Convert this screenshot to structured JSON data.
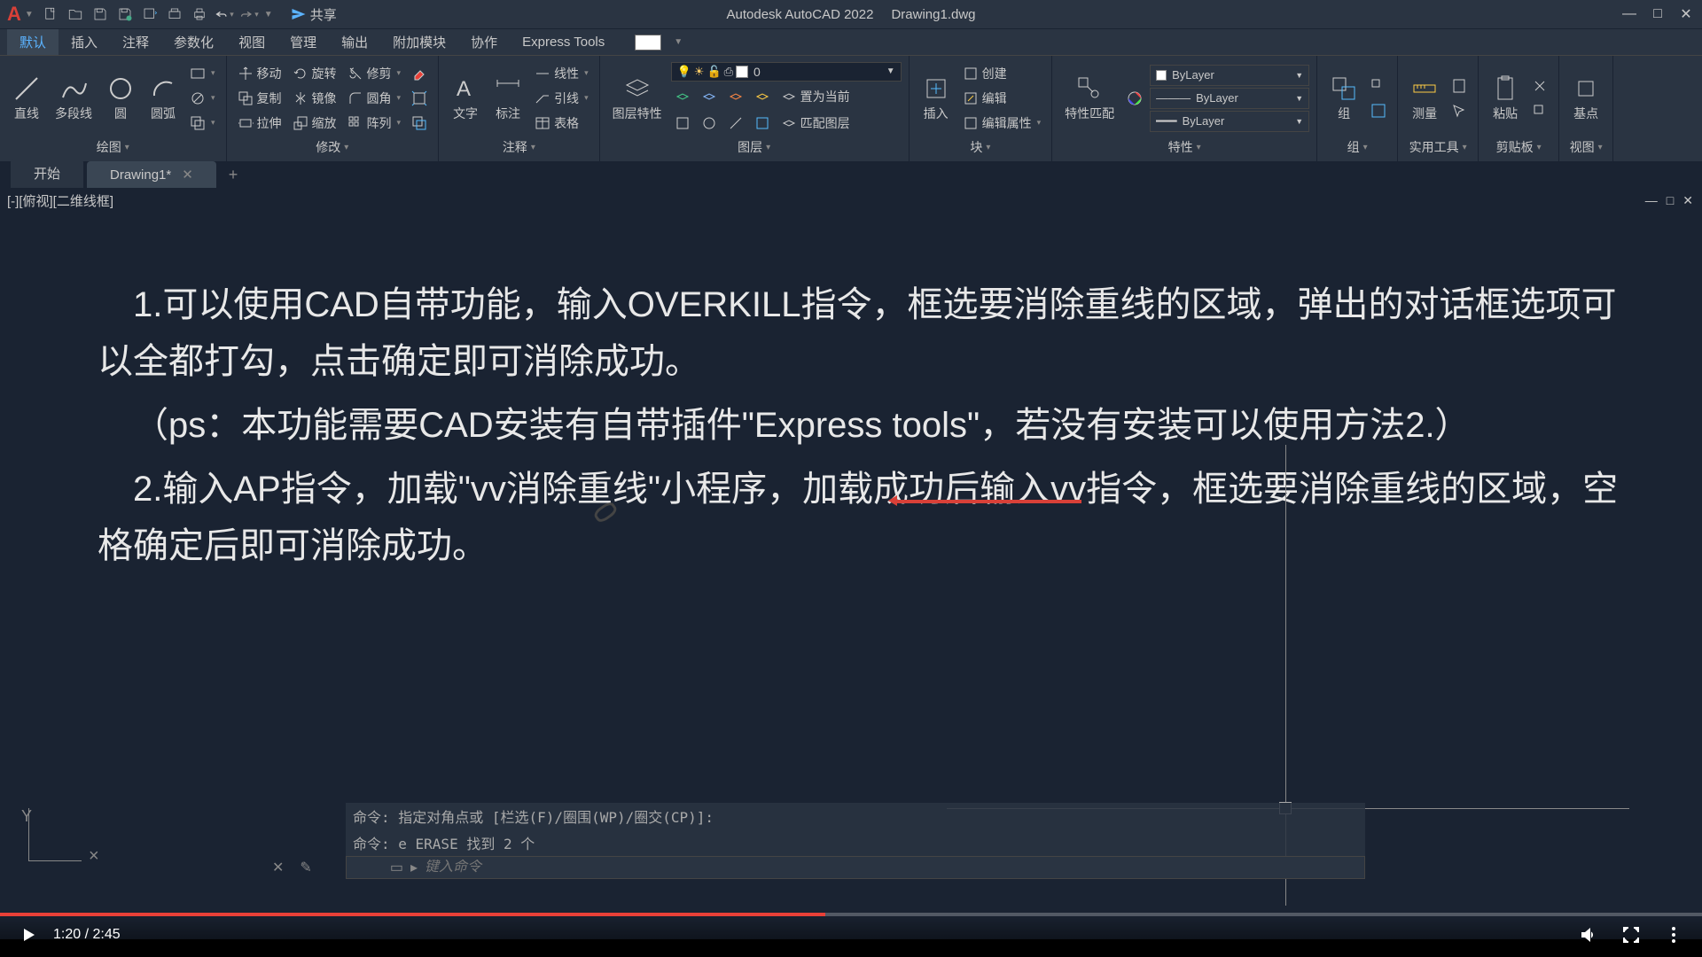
{
  "titlebar": {
    "app": "Autodesk AutoCAD 2022",
    "file": "Drawing1.dwg",
    "share": "共享"
  },
  "menubar": {
    "items": [
      "默认",
      "插入",
      "注释",
      "参数化",
      "视图",
      "管理",
      "输出",
      "附加模块",
      "协作",
      "Express Tools"
    ]
  },
  "ribbon": {
    "draw": {
      "label": "绘图",
      "line": "直线",
      "pline": "多段线",
      "circle": "圆",
      "arc": "圆弧"
    },
    "modify": {
      "label": "修改",
      "move": "移动",
      "rotate": "旋转",
      "trim": "修剪",
      "copy": "复制",
      "mirror": "镜像",
      "fillet": "圆角",
      "stretch": "拉伸",
      "scale": "缩放",
      "array": "阵列"
    },
    "annot": {
      "label": "注释",
      "text": "文字",
      "dim": "标注",
      "linear": "线性",
      "leader": "引线",
      "table": "表格"
    },
    "layers": {
      "label": "图层",
      "props": "图层特性",
      "current": "0",
      "setcurrent": "置为当前",
      "match": "匹配图层"
    },
    "block": {
      "label": "块",
      "insert": "插入",
      "create": "创建",
      "edit": "编辑",
      "attr": "编辑属性"
    },
    "props": {
      "label": "特性",
      "match": "特性匹配",
      "bylayer": "ByLayer"
    },
    "group": {
      "label": "组",
      "group": "组"
    },
    "util": {
      "label": "实用工具",
      "measure": "测量"
    },
    "clip": {
      "label": "剪贴板",
      "paste": "粘贴"
    },
    "view": {
      "label": "视图",
      "base": "基点"
    }
  },
  "filetabs": {
    "start": "开始",
    "drawing": "Drawing1*"
  },
  "viewport": {
    "label": "[-][俯视][二维线框]"
  },
  "content": {
    "p1": "1.可以使用CAD自带功能，输入OVERKILL指令，框选要消除重线的区域，弹出的对话框选项可以全都打勾，点击确定即可消除成功。",
    "p2": "（ps：本功能需要CAD安装有自带插件\"Express tools\"，若没有安装可以使用方法2.）",
    "p3": "2.输入AP指令，加载\"vv消除重线\"小程序，加载成功后输入vv指令，框选要消除重线的区域，空格确定后即可消除成功。"
  },
  "cmd": {
    "hist1": "命令: 指定对角点或 [栏选(F)/圈围(WP)/圈交(CP)]:",
    "hist2": "命令: e ERASE 找到 2 个",
    "placeholder": "键入命令"
  },
  "video": {
    "time": "1:20 / 2:45"
  }
}
